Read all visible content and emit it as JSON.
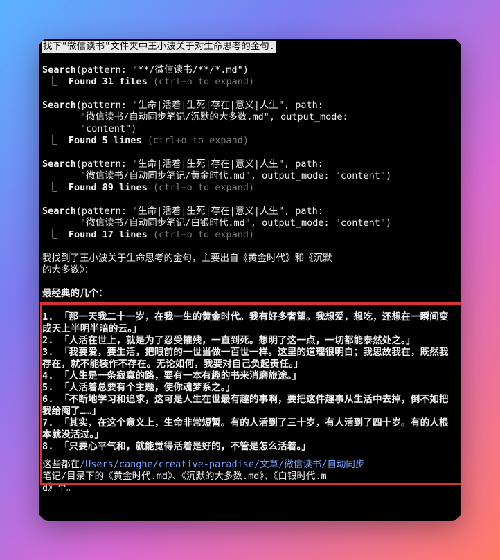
{
  "prompt": "找下\"微信读书\"文件夹中王小波关于对生命思考的金句.",
  "searches": [
    {
      "tool": "Search",
      "args_lines": [
        "(pattern: \"**/微信读书/**/*.md\")"
      ],
      "result": "Found 31 files",
      "hint": "(ctrl+o to expand)"
    },
    {
      "tool": "Search",
      "args_lines": [
        "(pattern: \"生命|活着|生死|存在|意义|人生\", path:",
        "\"微信读书/自动同步笔记/沉默的大多数.md\", output_mode:",
        "\"content\")"
      ],
      "result": "Found 5 lines",
      "hint": "(ctrl+o to expand)"
    },
    {
      "tool": "Search",
      "args_lines": [
        "(pattern: \"生命|活着|生死|存在|意义|人生\", path:",
        "\"微信读书/自动同步笔记/黄金时代.md\", output_mode: \"content\")"
      ],
      "result": "Found 89 lines",
      "hint": "(ctrl+o to expand)"
    },
    {
      "tool": "Search",
      "args_lines": [
        "(pattern: \"生命|活着|生死|存在|意义|人生\", path:",
        "\"微信读书/自动同步笔记/白银时代.md\", output_mode: \"content\")"
      ],
      "result": "Found 17 lines",
      "hint": "(ctrl+o to expand)"
    }
  ],
  "summary_line1": "我找到了王小波关于生命思考的金句，主要出自《黄金时代》和《沉默",
  "summary_line2": "的大多数》：",
  "classic_heading": "最经典的几个：",
  "quotes": [
    "1. 「那一天我二十一岁，在我一生的黄金时代。我有好多奢望。我想爱，想吃，还想在一瞬间变成天上半明半暗的云。」",
    "2. 「人活在世上，就是为了忍受摧残，一直到死。想明了这一点，一切都能泰然处之。」",
    "3. 「我要爱，要生活，把眼前的一世当做一百世一样。这里的道理很明白；我思故我在，既然我存在，就不能装作不存在。无论如何，我要对自己负起责任。」",
    "4. 「人生是一条寂寞的路，要有一本有趣的书来消磨旅途。」",
    "5. 「人活着总要有个主题，使你魂梦系之。」",
    "6. 「不断地学习和追求，这可是人生在世最有趣的事啊，要把这件趣事从生活中去掉，倒不如把我给阉了……」",
    "7. 「其实，在这个意义上，生命非常短暂。有的人活到了三十岁，有人活到了四十岁。有的人根本就没活过。」",
    "8. 「只要心平气和，就能觉得活着是好的，不管是怎么活着。」"
  ],
  "footer_prefix": "这些都在",
  "footer_path": "/Users/canghe/creative-paradise/文章/微信读书/自动同步",
  "footer_line2": "笔记/目录下的《黄金时代.md》、《沉默的大多数.md》、《白银时代.m",
  "footer_line3": "d》里。"
}
